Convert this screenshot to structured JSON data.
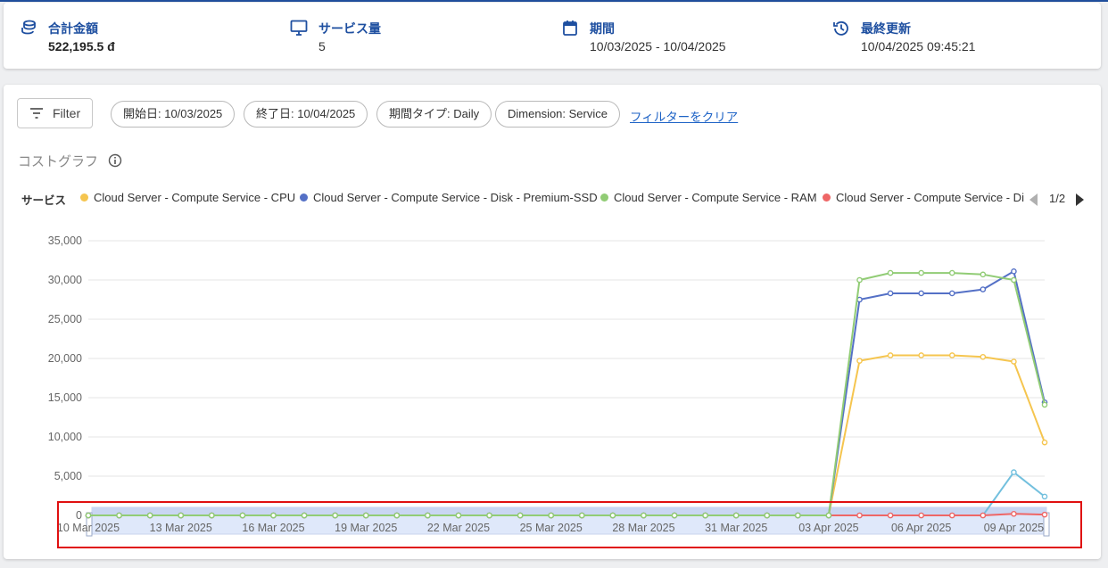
{
  "summary": {
    "total": {
      "label": "合計金額",
      "value": "522,195.5 đ"
    },
    "services": {
      "label": "サービス量",
      "value": "5"
    },
    "period": {
      "label": "期間",
      "value": "10/03/2025 - 10/04/2025"
    },
    "updated": {
      "label": "最終更新",
      "value": "10/04/2025 09:45:21"
    }
  },
  "filters": {
    "button_label": "Filter",
    "chips": [
      "開始日: 10/03/2025",
      "終了日: 10/04/2025",
      "期間タイプ: Daily",
      "Dimension: Service"
    ],
    "clear_label": "フィルターをクリア"
  },
  "graph": {
    "title": "コストグラフ",
    "legend_title": "サービス",
    "pager": "1/2"
  },
  "colors": {
    "cpu": "#f5c54f",
    "disk": "#5470c6",
    "ram": "#91cc75",
    "other_disk": "#ee6666",
    "fifth": "#73c0de",
    "accent": "#1e4fa0"
  },
  "chart_data": {
    "type": "line",
    "x": [
      "10 Mar 2025",
      "11 Mar 2025",
      "12 Mar 2025",
      "13 Mar 2025",
      "14 Mar 2025",
      "15 Mar 2025",
      "16 Mar 2025",
      "17 Mar 2025",
      "18 Mar 2025",
      "19 Mar 2025",
      "20 Mar 2025",
      "21 Mar 2025",
      "22 Mar 2025",
      "23 Mar 2025",
      "24 Mar 2025",
      "25 Mar 2025",
      "26 Mar 2025",
      "27 Mar 2025",
      "28 Mar 2025",
      "29 Mar 2025",
      "30 Mar 2025",
      "31 Mar 2025",
      "01 Apr 2025",
      "02 Apr 2025",
      "03 Apr 2025",
      "04 Apr 2025",
      "05 Apr 2025",
      "06 Apr 2025",
      "07 Apr 2025",
      "08 Apr 2025",
      "09 Apr 2025",
      "10 Apr 2025"
    ],
    "x_tick_labels": [
      "10 Mar 2025",
      "13 Mar 2025",
      "16 Mar 2025",
      "19 Mar 2025",
      "22 Mar 2025",
      "25 Mar 2025",
      "28 Mar 2025",
      "31 Mar 2025",
      "03 Apr 2025",
      "06 Apr 2025",
      "09 Apr 2025"
    ],
    "y_ticks": [
      "0",
      "5,000",
      "10,000",
      "15,000",
      "20,000",
      "25,000",
      "30,000",
      "35,000"
    ],
    "ylim": [
      0,
      35000
    ],
    "grid": true,
    "legend_position": "top",
    "series": [
      {
        "name": "Cloud Server - Compute Service - CPU",
        "color_key": "cpu",
        "values": [
          0,
          0,
          0,
          0,
          0,
          0,
          0,
          0,
          0,
          0,
          0,
          0,
          0,
          0,
          0,
          0,
          0,
          0,
          0,
          0,
          0,
          0,
          0,
          0,
          0,
          19700,
          20400,
          20400,
          20400,
          20200,
          19600,
          9300
        ]
      },
      {
        "name": "Cloud Server - Compute Service - Disk - Premium-SSD",
        "color_key": "disk",
        "values": [
          0,
          0,
          0,
          0,
          0,
          0,
          0,
          0,
          0,
          0,
          0,
          0,
          0,
          0,
          0,
          0,
          0,
          0,
          0,
          0,
          0,
          0,
          0,
          0,
          0,
          27500,
          28300,
          28300,
          28300,
          28800,
          31100,
          14400
        ]
      },
      {
        "name": "Cloud Server - Compute Service - RAM",
        "color_key": "ram",
        "values": [
          0,
          0,
          0,
          0,
          0,
          0,
          0,
          0,
          0,
          0,
          0,
          0,
          0,
          0,
          0,
          0,
          0,
          0,
          0,
          0,
          0,
          0,
          0,
          0,
          0,
          30000,
          30900,
          30900,
          30900,
          30700,
          30000,
          14100
        ]
      },
      {
        "name": "Cloud Server - Compute Service - Di",
        "color_key": "other_disk",
        "values": [
          0,
          0,
          0,
          0,
          0,
          0,
          0,
          0,
          0,
          0,
          0,
          0,
          0,
          0,
          0,
          0,
          0,
          0,
          0,
          0,
          0,
          0,
          0,
          0,
          0,
          0,
          0,
          0,
          0,
          0,
          200,
          100
        ]
      },
      {
        "color_key": "fifth",
        "values": [
          0,
          0,
          0,
          0,
          0,
          0,
          0,
          0,
          0,
          0,
          0,
          0,
          0,
          0,
          0,
          0,
          0,
          0,
          0,
          0,
          0,
          0,
          0,
          0,
          0,
          0,
          0,
          0,
          0,
          0,
          5500,
          2400
        ]
      }
    ]
  }
}
